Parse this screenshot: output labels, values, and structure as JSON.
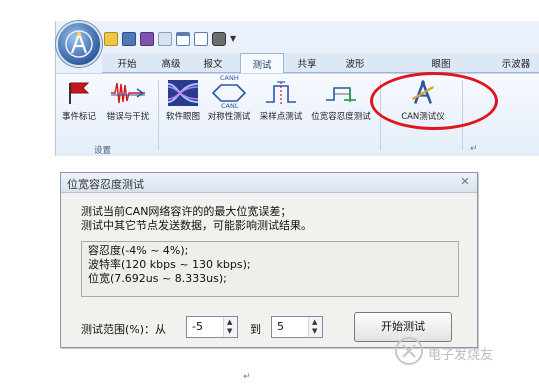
{
  "ribbon": {
    "tabs": [
      "开始",
      "高级",
      "报文",
      "测试",
      "共享",
      "波形",
      "眼图",
      "示波器"
    ],
    "active_tab": "测试",
    "buttons": [
      {
        "label": "事件标记",
        "icon": "flag-icon"
      },
      {
        "label": "错误与干扰",
        "icon": "interference-icon"
      },
      {
        "label": "软件眼图",
        "icon": "eye-diagram-icon"
      },
      {
        "label": "对称性测试",
        "icon": "symmetry-icon"
      },
      {
        "label": "采样点测试",
        "icon": "sample-point-icon"
      },
      {
        "label": "位宽容忍度测试",
        "icon": "bit-width-icon"
      },
      {
        "label": "CAN测试仪",
        "icon": "can-tester-icon"
      }
    ],
    "group_label": "设置",
    "symmetry_top_label": "CANH",
    "symmetry_bottom_label": "CANL"
  },
  "dialog": {
    "title": "位宽容忍度测试",
    "description_line1": "测试当前CAN网络容许的的最大位宽误差；",
    "description_line2": "测试中其它节点发送数据，可能影响测试结果。",
    "info_line1": "容忍度(-4% ~ 4%);",
    "info_line2": "波特率(120 kbps ~ 130 kbps);",
    "info_line3": "位宽(7.692us ~ 8.333us);",
    "range_label": "测试范围(%)：从",
    "from_value": "-5",
    "to_label": "到",
    "to_value": "5",
    "start_button": "开始测试"
  },
  "paragraph_mark": "↵",
  "watermark": "电子发烧友",
  "colors": {
    "highlight": "#e0161f",
    "ribbon_bg": "#eaf1fb",
    "accent": "#2f5f9e"
  }
}
